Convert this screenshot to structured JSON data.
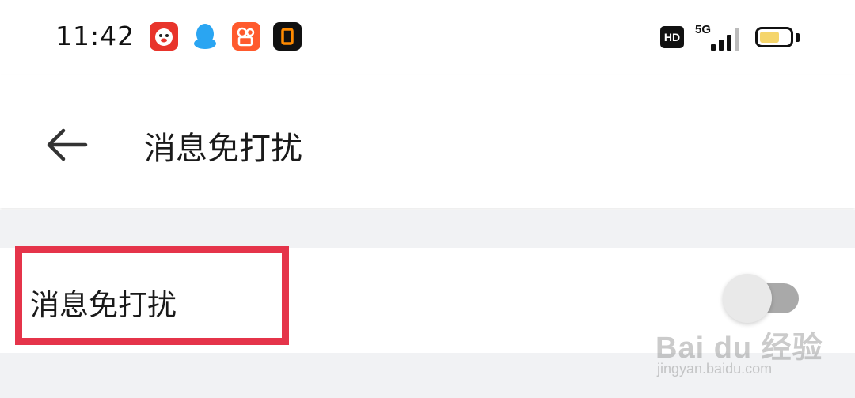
{
  "status_bar": {
    "time": "11:42",
    "app_icons": [
      "jd-dog-icon",
      "qq-penguin-icon",
      "kuaishou-icon",
      "orange-square-app-icon"
    ],
    "hd_label": "HD",
    "network_label": "5G",
    "battery_color": "#f5d56b"
  },
  "header": {
    "back_icon": "back-arrow-icon",
    "title": "消息免打扰"
  },
  "settings": {
    "items": [
      {
        "label": "消息免打扰",
        "toggle_on": false
      }
    ],
    "highlight_color": "#e5344a"
  },
  "watermark": {
    "logo_text": "Bai du 经验",
    "url": "jingyan.baidu.com"
  }
}
